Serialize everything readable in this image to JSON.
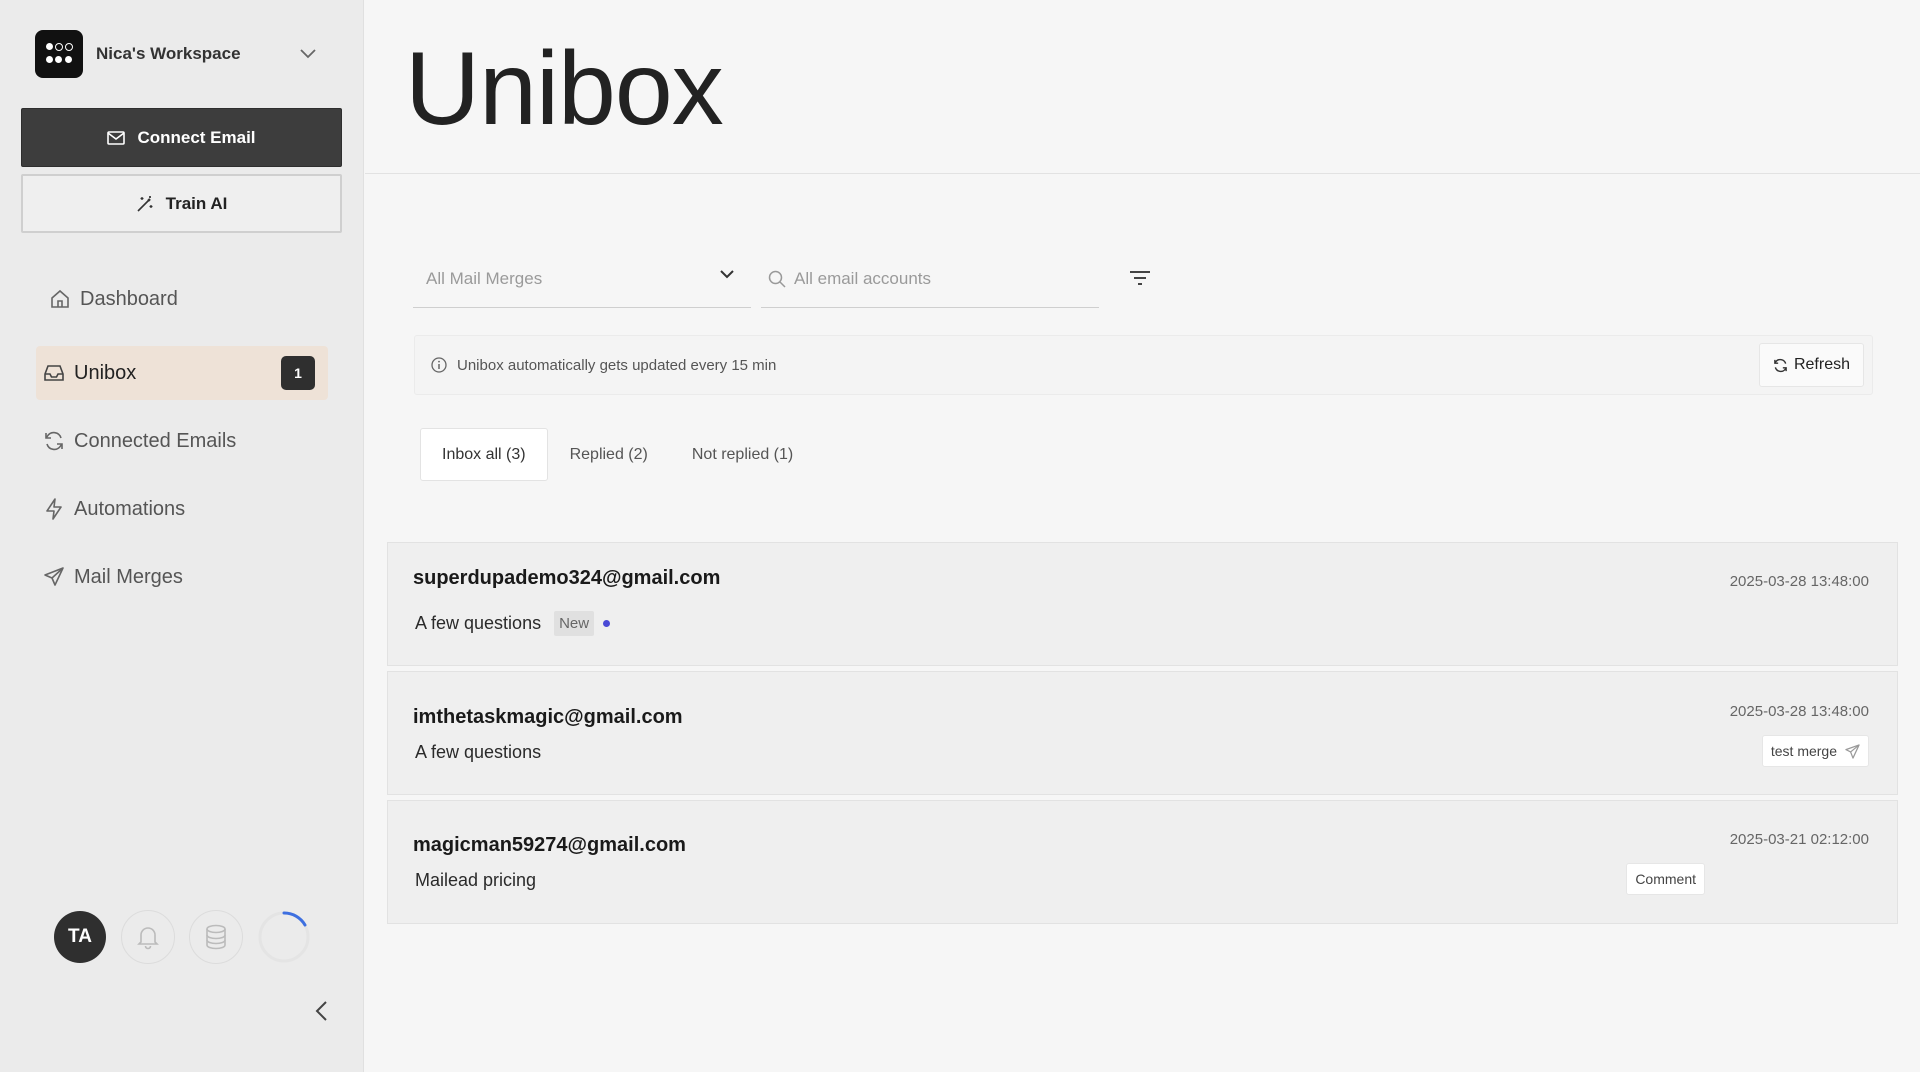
{
  "sidebar": {
    "workspace_name": "Nica's Workspace",
    "connect_email_label": "Connect Email",
    "train_ai_label": "Train AI",
    "nav": [
      {
        "label": "Dashboard",
        "icon": "home-icon"
      },
      {
        "label": "Unibox",
        "icon": "inbox-icon",
        "badge": "1"
      },
      {
        "label": "Connected Emails",
        "icon": "sync-icon"
      },
      {
        "label": "Automations",
        "icon": "bolt-icon"
      },
      {
        "label": "Mail Merges",
        "icon": "send-icon"
      }
    ],
    "avatar_initials": "TA"
  },
  "header": {
    "title": "Unibox"
  },
  "filters": {
    "mail_merge_select": "All Mail Merges",
    "email_search_placeholder": "All email accounts"
  },
  "info": {
    "message": "Unibox automatically gets updated every 15 min",
    "refresh_label": "Refresh"
  },
  "tabs": [
    {
      "label": "Inbox all (3)",
      "active": true
    },
    {
      "label": "Replied (2)",
      "active": false
    },
    {
      "label": "Not replied (1)",
      "active": false
    }
  ],
  "messages": [
    {
      "from": "superdupademo324@gmail.com",
      "subject": "A few questions",
      "date": "2025-03-28 13:48:00",
      "tag": "New",
      "unread": true
    },
    {
      "from": "imthetaskmagic@gmail.com",
      "subject": "A few questions",
      "date": "2025-03-28 13:48:00",
      "pill": "test merge"
    },
    {
      "from": "magicman59274@gmail.com",
      "subject": "Mailead pricing",
      "date": "2025-03-21 02:12:00",
      "pill": "Comment"
    }
  ],
  "colors": {
    "accent_active_nav": "#eee2d7",
    "unread_dot": "#4a4ad6",
    "dark": "#3d3d3d"
  }
}
